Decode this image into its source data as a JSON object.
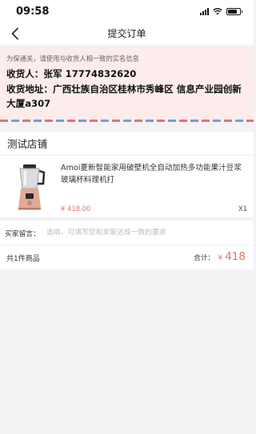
{
  "status_bar": {
    "time": "09:58",
    "battery_level": 0.8
  },
  "nav": {
    "title": "提交订单",
    "back_icon": "chevron-left-icon"
  },
  "address": {
    "notice": "为保通关，请使用与收货人相一致的实名信息",
    "receiver_label": "收货人：",
    "receiver_name": "张军",
    "receiver_phone": "17774832620",
    "address_label": "收货地址：",
    "address_text": "广西壮族自治区桂林市秀峰区 信息产业园创新大厦a307",
    "stripe_colors": [
      "#e8707a",
      "#7a9bd8"
    ]
  },
  "shop": {
    "name": "测试店铺",
    "product": {
      "title": "Amoi夏新智能家用破壁机全自动加热多功能果汁豆浆玻璃杯料理机打",
      "price": "¥ 418.00",
      "quantity": "X1",
      "image_icon": "blender-icon"
    }
  },
  "message": {
    "label": "买家留言：",
    "placeholder": "选填，可填写您和卖家达成一致的要求"
  },
  "summary": {
    "count": "共1件商品",
    "total_label": "合计：",
    "currency": "¥",
    "total": "418"
  },
  "colors": {
    "accent": "#e8736d",
    "address_bg": "#fcecec"
  }
}
